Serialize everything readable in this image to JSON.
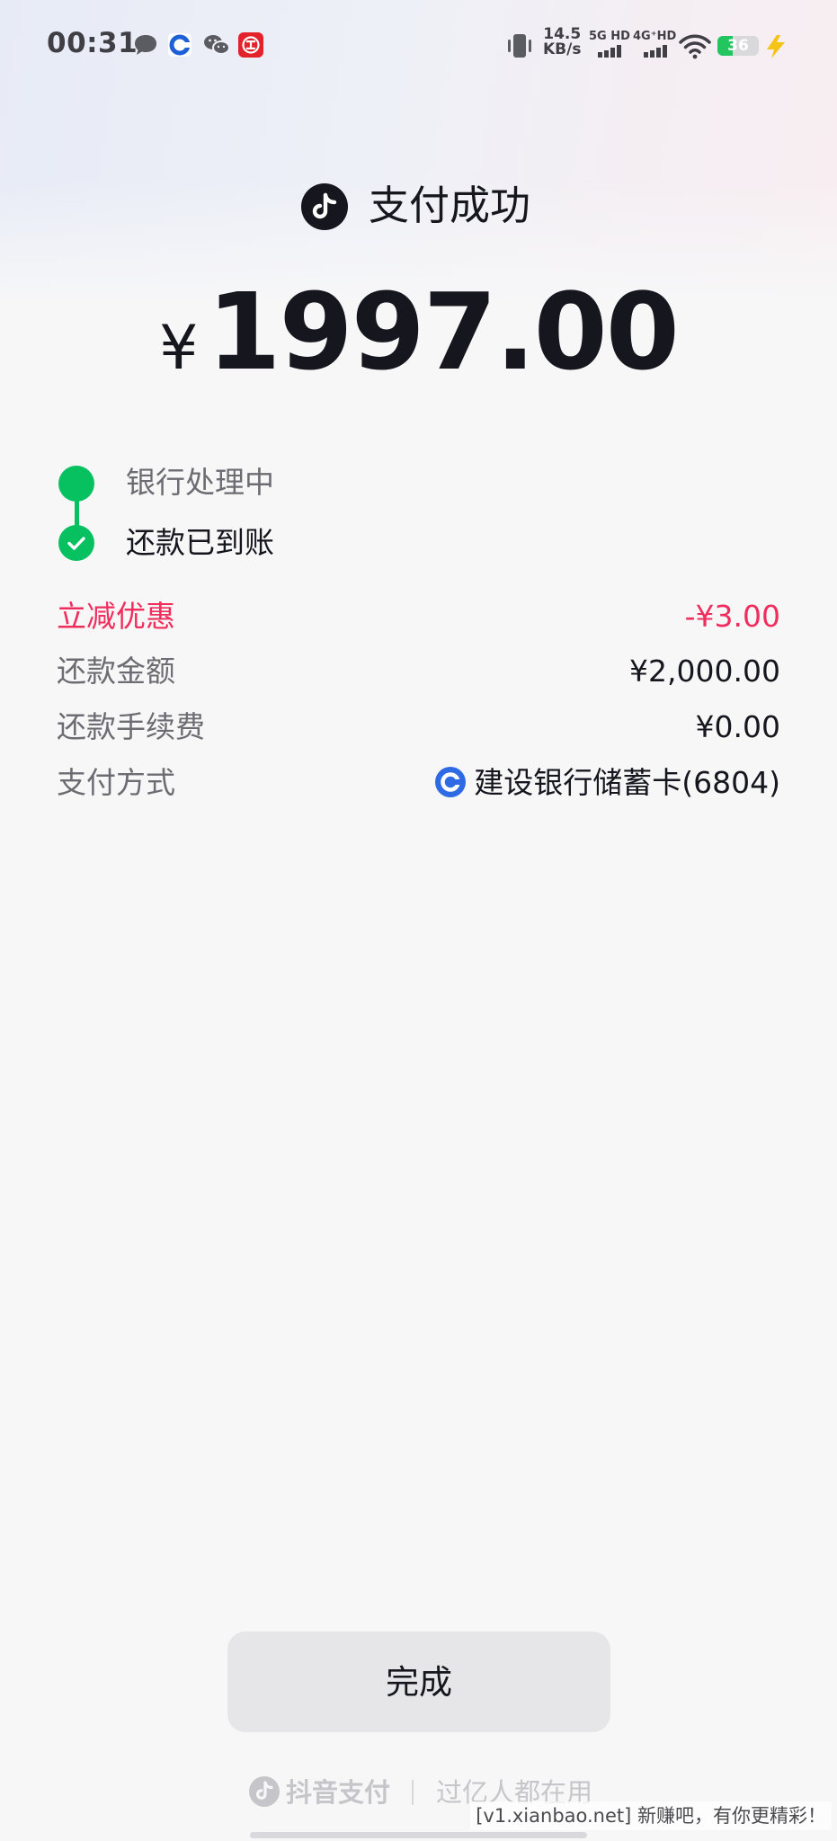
{
  "status_bar": {
    "time": "00:31",
    "notification_icons": [
      "message-icon",
      "ccb-bank-icon",
      "wechat-icon",
      "citic-bank-icon"
    ],
    "net_speed_value": "14.5",
    "net_speed_unit": "KB/s",
    "sim1_label": "5G HD",
    "sim2_label": "4G⁺HD",
    "battery_level": "36",
    "battery_fraction": 0.36,
    "charging": true
  },
  "header": {
    "title": "支付成功",
    "currency_symbol": "¥",
    "amount": "1997.00"
  },
  "progress": {
    "steps": [
      {
        "label": "银行处理中",
        "state": "done"
      },
      {
        "label": "还款已到账",
        "state": "current-done"
      }
    ]
  },
  "details": {
    "rows": [
      {
        "label": "立减优惠",
        "value": "-¥3.00"
      },
      {
        "label": "还款金额",
        "value": "¥2,000.00"
      },
      {
        "label": "还款手续费",
        "value": "¥0.00"
      },
      {
        "label": "支付方式",
        "value": "建设银行储蓄卡(6804)"
      }
    ]
  },
  "actions": {
    "done_label": "完成"
  },
  "footer": {
    "brand": "抖音支付",
    "slogan": "过亿人都在用"
  },
  "watermark": "[v1.xianbao.net] 新赚吧，有你更精彩！",
  "colors": {
    "accent_green": "#07c160",
    "discount_red": "#f02d5c",
    "text_primary": "#16161e",
    "text_secondary": "#6c6c72",
    "ccb_blue": "#2d6ae3"
  }
}
